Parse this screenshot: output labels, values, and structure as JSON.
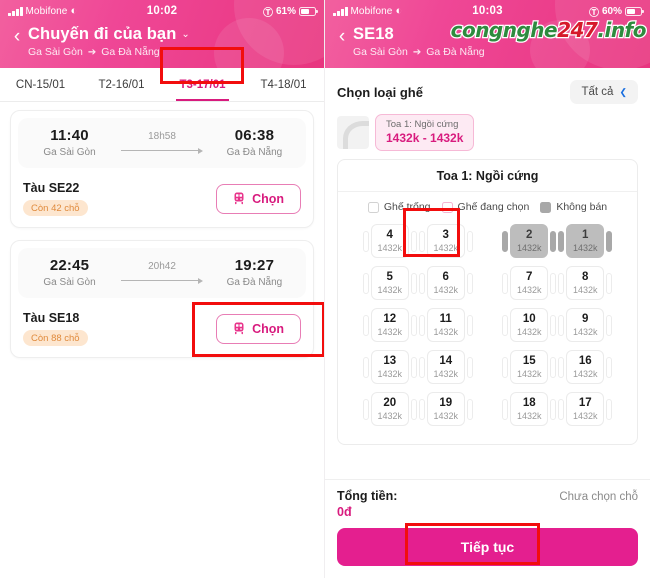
{
  "left": {
    "status": {
      "carrier": "Mobifone",
      "time": "10:02",
      "battery": "61%"
    },
    "header": {
      "title": "Chuyến đi của bạn",
      "from": "Ga Sài Gòn",
      "to": "Ga Đà Nẵng",
      "arrow": "➔",
      "chevron": "⌄",
      "back": "‹"
    },
    "tabs": [
      {
        "label": "CN-15/01",
        "active": false
      },
      {
        "label": "T2-16/01",
        "active": false
      },
      {
        "label": "T3-17/01",
        "active": true
      },
      {
        "label": "T4-18/01",
        "active": false
      }
    ],
    "trips": [
      {
        "depart_time": "11:40",
        "depart_station": "Ga Sài Gòn",
        "duration": "18h58",
        "arrive_time": "06:38",
        "arrive_station": "Ga Đà Nẵng",
        "train": "Tàu SE22",
        "seats": "Còn 42 chỗ",
        "button": "Chọn"
      },
      {
        "depart_time": "22:45",
        "depart_station": "Ga Sài Gòn",
        "duration": "20h42",
        "arrive_time": "19:27",
        "arrive_station": "Ga Đà Nẵng",
        "train": "Tàu SE18",
        "seats": "Còn 88 chỗ",
        "button": "Chọn"
      }
    ]
  },
  "right": {
    "status": {
      "carrier": "Mobifone",
      "time": "10:03",
      "battery": "60%"
    },
    "header": {
      "title": "SE18",
      "from": "Ga Sài Gòn",
      "to": "Ga Đà Nẵng",
      "arrow": "➔",
      "back": "‹"
    },
    "watermark": {
      "part1": "congnghe",
      "part2": "247",
      "part3": ".info"
    },
    "seat_type": {
      "title": "Chọn loại ghế",
      "filter_label": "Tất cả",
      "filter_chevron": "❯"
    },
    "coach_card": {
      "name": "Toa 1: Ngồi cứng",
      "price": "1432k - 1432k"
    },
    "coach_panel": {
      "title": "Toa 1: Ngồi cứng",
      "legend": [
        {
          "label": "Ghế trống",
          "kind": "empty"
        },
        {
          "label": "Ghế đang chọn",
          "kind": "sel"
        },
        {
          "label": "Không bán",
          "kind": "na"
        }
      ],
      "seat_rows": [
        {
          "left": [
            {
              "n": "4",
              "p": "1432k",
              "na": false
            },
            {
              "n": "3",
              "p": "1432k",
              "na": false
            }
          ],
          "right": [
            {
              "n": "2",
              "p": "1432k",
              "na": true
            },
            {
              "n": "1",
              "p": "1432k",
              "na": true
            }
          ]
        },
        {
          "left": [
            {
              "n": "5",
              "p": "1432k",
              "na": false
            },
            {
              "n": "6",
              "p": "1432k",
              "na": false
            }
          ],
          "right": [
            {
              "n": "7",
              "p": "1432k",
              "na": false
            },
            {
              "n": "8",
              "p": "1432k",
              "na": false
            }
          ]
        },
        {
          "left": [
            {
              "n": "12",
              "p": "1432k",
              "na": false
            },
            {
              "n": "11",
              "p": "1432k",
              "na": false
            }
          ],
          "right": [
            {
              "n": "10",
              "p": "1432k",
              "na": false
            },
            {
              "n": "9",
              "p": "1432k",
              "na": false
            }
          ]
        },
        {
          "left": [
            {
              "n": "13",
              "p": "1432k",
              "na": false
            },
            {
              "n": "14",
              "p": "1432k",
              "na": false
            }
          ],
          "right": [
            {
              "n": "15",
              "p": "1432k",
              "na": false
            },
            {
              "n": "16",
              "p": "1432k",
              "na": false
            }
          ]
        },
        {
          "left": [
            {
              "n": "20",
              "p": "1432k",
              "na": false
            },
            {
              "n": "19",
              "p": "1432k",
              "na": false
            }
          ],
          "right": [
            {
              "n": "18",
              "p": "1432k",
              "na": false
            },
            {
              "n": "17",
              "p": "1432k",
              "na": false
            }
          ]
        }
      ]
    },
    "footer": {
      "total_label": "Tổng tiền:",
      "total_value": "0đ",
      "note": "Chưa chọn chỗ",
      "cta": "Tiếp tục"
    }
  },
  "colors": {
    "brand_pink": "#d81b7e",
    "cta_pink": "#e41f8f",
    "annotation_red": "#f20d0d",
    "unavailable_grey": "#bdbdbd"
  }
}
